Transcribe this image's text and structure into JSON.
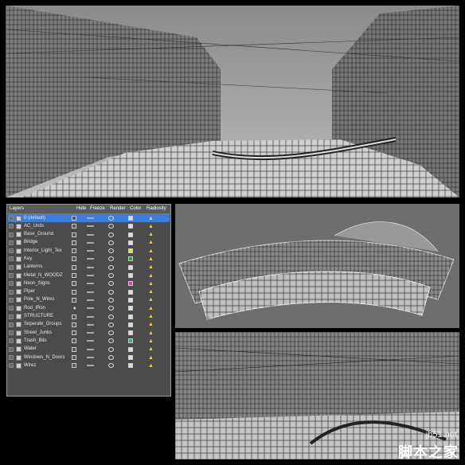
{
  "layers_panel": {
    "headers": {
      "layers": "Layers",
      "hide": "Hide",
      "freeze": "Freeze",
      "render": "Render",
      "color": "Color",
      "radiosity": "Radiosity"
    },
    "rows": [
      {
        "name": "0 (default)",
        "selected": true,
        "checked": true,
        "color": "#dddddd"
      },
      {
        "name": "AC_Units",
        "color": "#dddddd"
      },
      {
        "name": "Base_Ground",
        "color": "#dddddd"
      },
      {
        "name": "Bridge",
        "color": "#dddddd"
      },
      {
        "name": "Interior_Light_Tex",
        "color": "#e8e040"
      },
      {
        "name": "Key",
        "color": "#30a030"
      },
      {
        "name": "Lanterns",
        "color": "#dddddd"
      },
      {
        "name": "Metal_N_WOODZ",
        "color": "#dddddd"
      },
      {
        "name": "Neon_Signs",
        "color": "#e040c0"
      },
      {
        "name": "Piper",
        "color": "#dddddd"
      },
      {
        "name": "Pole_N_Wires",
        "color": "#dddddd"
      },
      {
        "name": "Rod_IRon",
        "color": "#dddddd",
        "light": true
      },
      {
        "name": "STRUCTURE",
        "color": "#dddddd"
      },
      {
        "name": "Seperate_Groups",
        "color": "#dddddd"
      },
      {
        "name": "Street_Junks",
        "color": "#dddddd"
      },
      {
        "name": "Trash_Bits",
        "color": "#30b090"
      },
      {
        "name": "Water",
        "color": "#dddddd"
      },
      {
        "name": "Windows_N_Doors",
        "color": "#dddddd"
      },
      {
        "name": "Wirez",
        "color": "#dddddd"
      }
    ]
  },
  "watermark": {
    "url": "jb51.net",
    "brand": "脚本之家"
  },
  "colors": {
    "selection": "#3c7edc",
    "panel_bg": "#4b4b4b",
    "viewport_bg": "#6a6a6a"
  }
}
